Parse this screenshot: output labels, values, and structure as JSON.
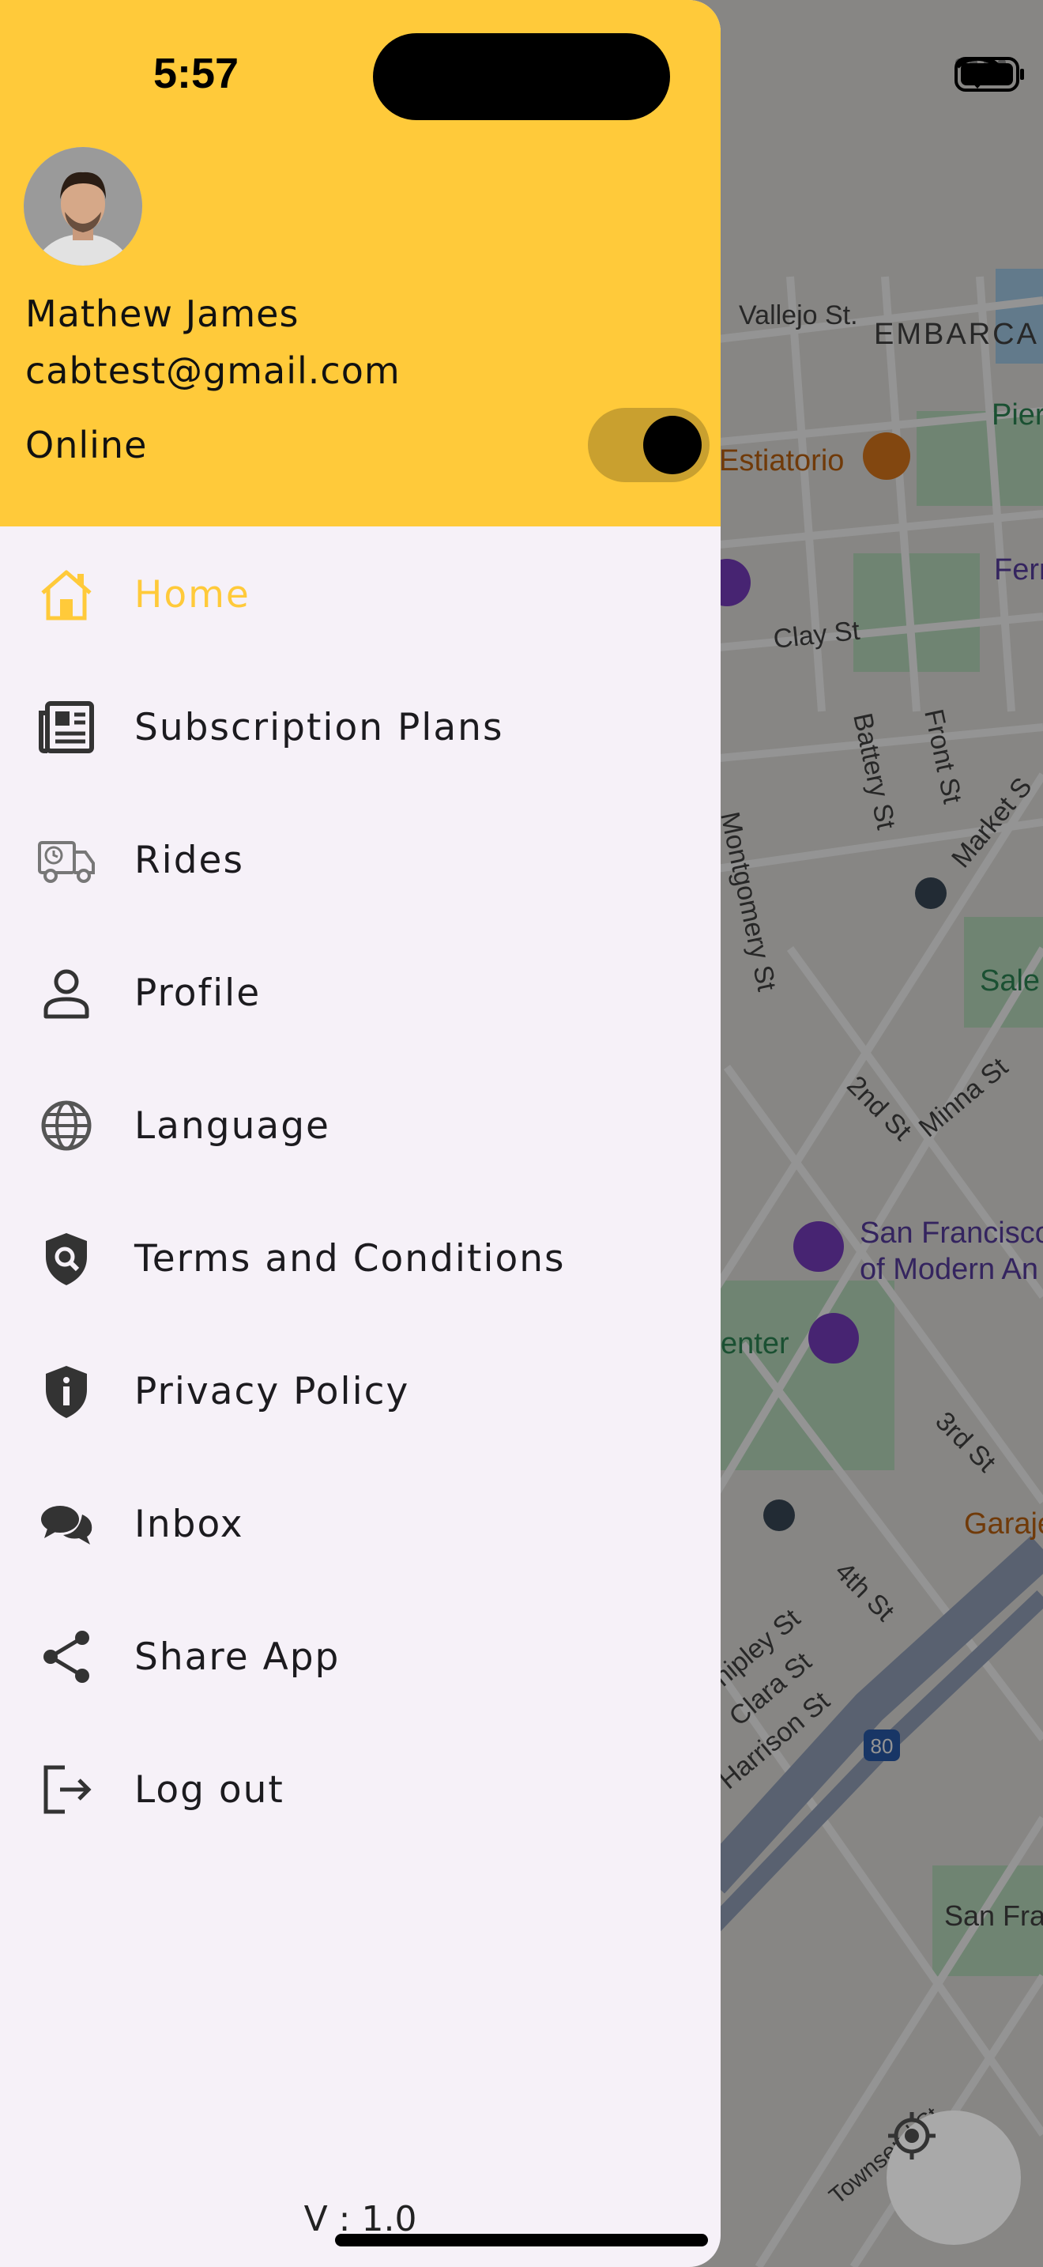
{
  "status_bar": {
    "time": "5:57"
  },
  "drawer": {
    "user": {
      "name": "Mathew James",
      "email": "cabtest@gmail.com"
    },
    "online": {
      "label": "Online",
      "enabled": true
    },
    "menu": [
      {
        "label": "Home",
        "icon": "home-icon",
        "active": true
      },
      {
        "label": "Subscription Plans",
        "icon": "newspaper-icon"
      },
      {
        "label": "Rides",
        "icon": "delivery-truck-icon"
      },
      {
        "label": "Profile",
        "icon": "person-icon"
      },
      {
        "label": "Language",
        "icon": "globe-icon"
      },
      {
        "label": "Terms and Conditions",
        "icon": "shield-search-icon"
      },
      {
        "label": "Privacy Policy",
        "icon": "shield-info-icon"
      },
      {
        "label": "Inbox",
        "icon": "chat-bubbles-icon"
      },
      {
        "label": "Share App",
        "icon": "share-icon"
      },
      {
        "label": "Log out",
        "icon": "logout-icon"
      }
    ],
    "version": "V : 1.0"
  },
  "map": {
    "labels": {
      "vallejo": "Vallejo St.",
      "embarca": "EMBARCA",
      "estiatorio": "Estiatorio",
      "pier": "Pier",
      "ferr": "Ferr",
      "clay": "Clay St",
      "battery": "Battery St",
      "front": "Front St",
      "market": "Market S",
      "montgomery": "Montgomery St",
      "sale": "Sale",
      "second": "2nd St",
      "minna": "Minna St",
      "sfmoma1": "San Francisco",
      "sfmoma2": "of Modern An",
      "center": "enter",
      "third": "3rd St",
      "garaje": "Garaje",
      "fourth": "4th St",
      "shipley": "hipley St",
      "clara": "Clara St",
      "harrison": "Harrison St",
      "interstate": "80",
      "sanfra": "San Fra",
      "townsend": "Townsend St"
    }
  },
  "colors": {
    "accent": "#ffca3a",
    "drawer_bg": "#f6f1f8",
    "text": "#1c1b1f",
    "icon": "#444444"
  }
}
